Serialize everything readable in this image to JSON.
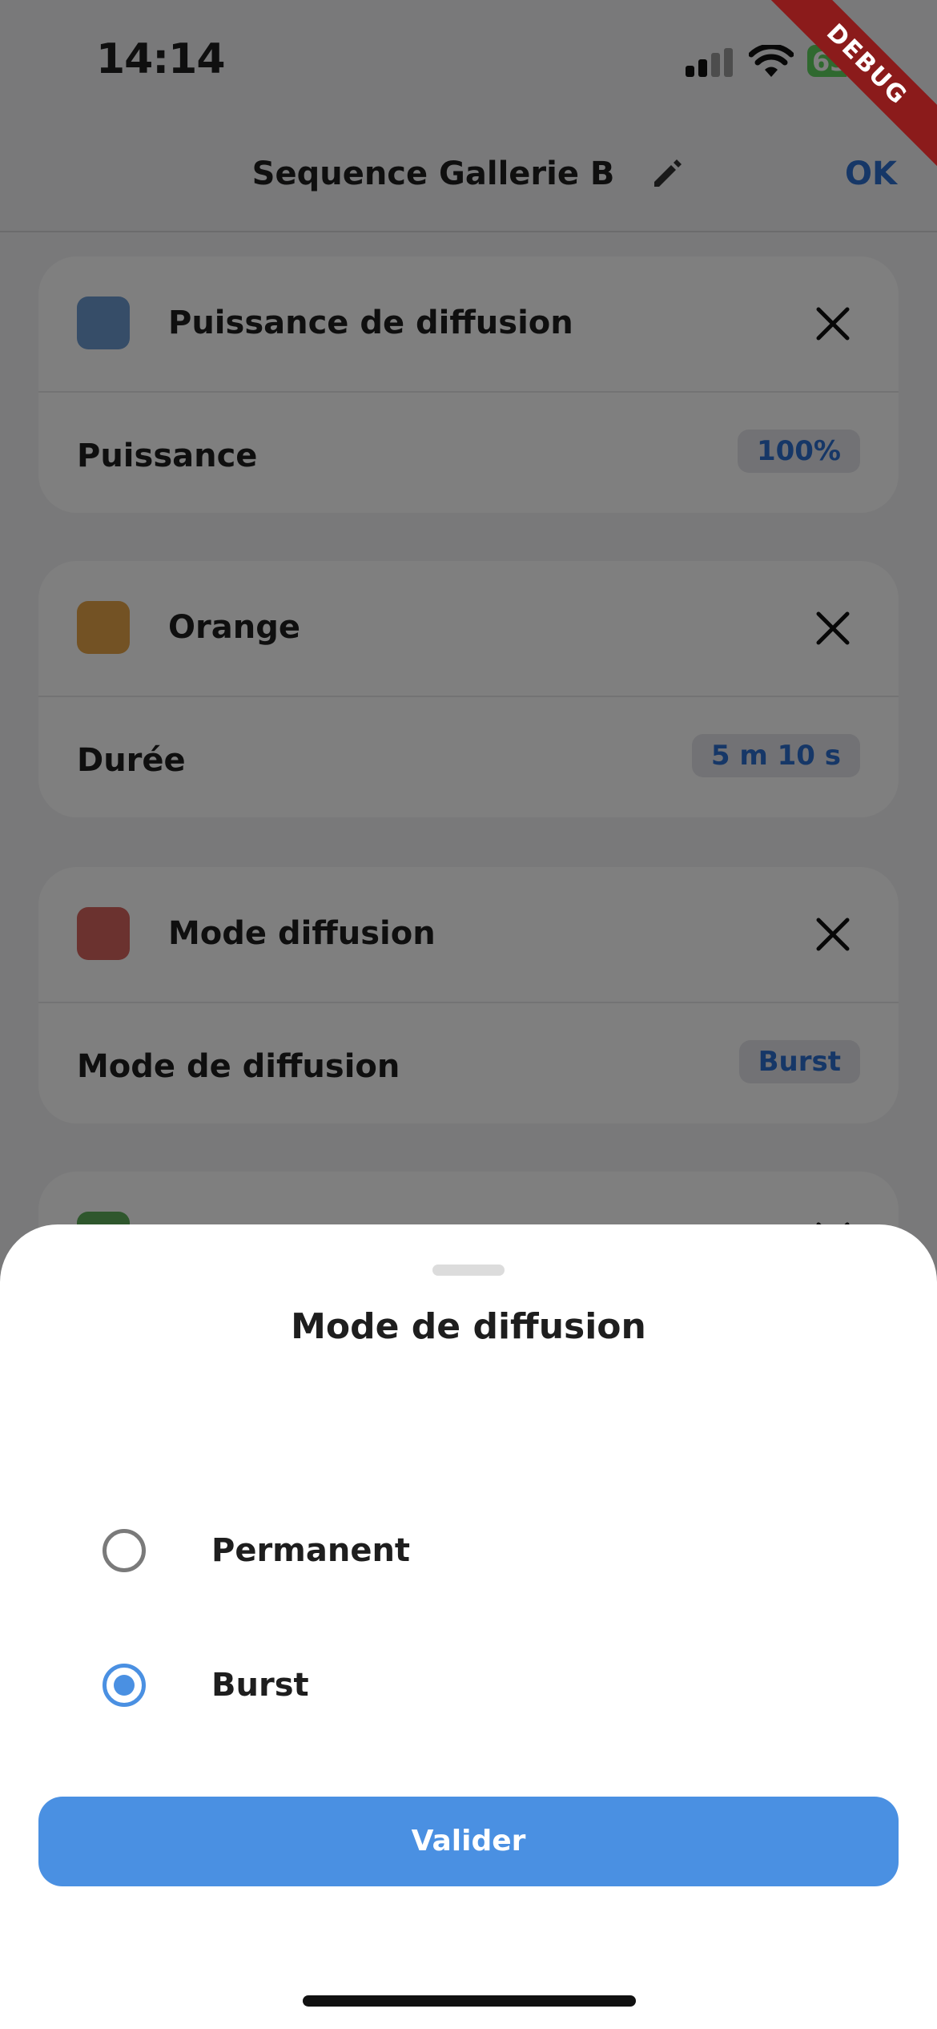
{
  "status_bar": {
    "time": "14:14",
    "battery": "63",
    "battery_level": 0.63
  },
  "header": {
    "title": "Sequence Gallerie B",
    "ok_label": "OK"
  },
  "cards": [
    {
      "title": "Puissance de diffusion",
      "color": "#6d9bd1",
      "row_label": "Puissance",
      "value": "100%"
    },
    {
      "title": "Orange",
      "color": "#e6a549",
      "row_label": "Durée",
      "value": "5 m 10 s"
    },
    {
      "title": "Mode diffusion",
      "color": "#d6655f",
      "row_label": "Mode de diffusion",
      "value": "Burst"
    },
    {
      "color": "#5fae5b"
    }
  ],
  "debug_label": "DEBUG",
  "sheet": {
    "title": "Mode de diffusion",
    "options": [
      {
        "label": "Permanent",
        "selected": false
      },
      {
        "label": "Burst",
        "selected": true
      }
    ],
    "validate_label": "Valider"
  },
  "colors": {
    "accent": "#4a90e2",
    "link": "#2d6fcf"
  }
}
